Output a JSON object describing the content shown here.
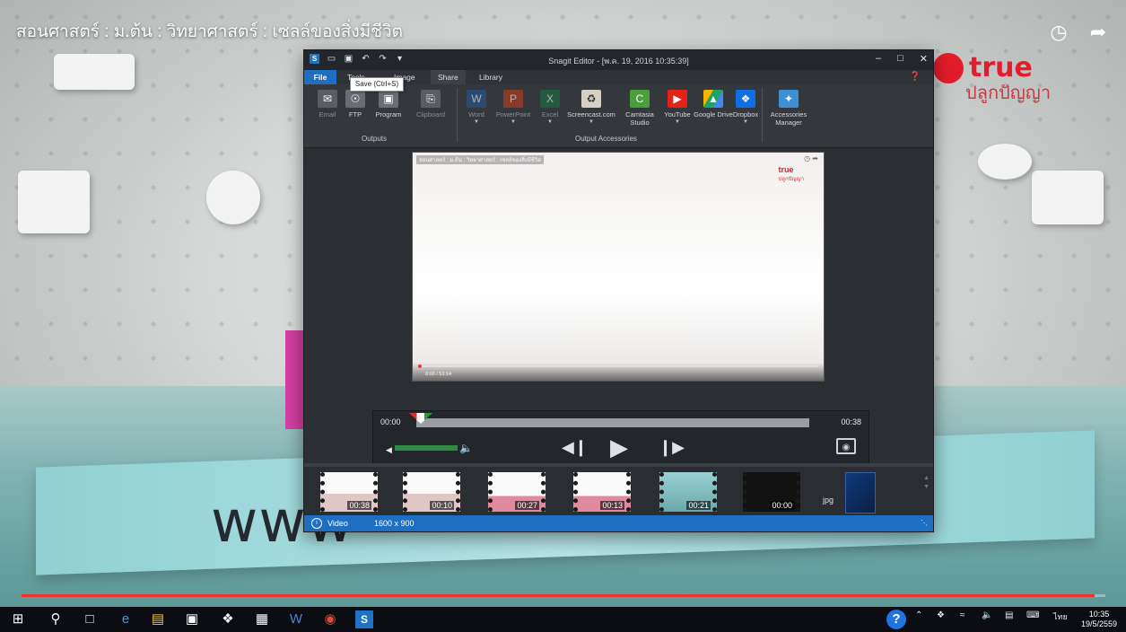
{
  "video": {
    "title": "สอนศาสตร์ : ม.ต้น : วิทยาศาสตร์ : เซลล์ของสิ่งมีชีวิต",
    "brand_name": "true",
    "brand_sub": "ปลูกปัญญา",
    "banner_text": "www",
    "progress_fraction": 0.99
  },
  "snagit": {
    "window_title": "Snagit Editor - [พ.ค. 19, 2016 10:35:39]",
    "menu": [
      "File",
      "Tools",
      "Image",
      "Share",
      "Library"
    ],
    "active_menu": "Share",
    "tooltip": "Save (Ctrl+S)",
    "outputs": {
      "label": "Outputs",
      "items": [
        "Email",
        "FTP",
        "Program",
        "Clipboard"
      ]
    },
    "accessories": {
      "label": "Output Accessories",
      "items": [
        "Word",
        "PowerPoint",
        "Excel",
        "Screencast.com",
        "Camtasia Studio",
        "YouTube",
        "Google Drive",
        "Dropbox"
      ]
    },
    "manager": "Accessories Manager",
    "capture": {
      "title": "สอนศาสตร์ : ม.ต้น : วิทยาศาสตร์ : เซลล์ของสิ่งมีชีวิต",
      "brand_name": "true",
      "brand_sub": "ปลูกปัญญา",
      "time": "0:00 / 53:14"
    },
    "player": {
      "time_start": "00:00",
      "time_end": "00:38"
    },
    "tray": {
      "thumbnails": [
        "00:38",
        "00:10",
        "00:27",
        "00:13",
        "00:21",
        "00:00"
      ],
      "jpg_label": "jpg"
    },
    "status": {
      "kind": "Video",
      "dimensions": "1600 x 900"
    }
  },
  "taskbar": {
    "lang": "ไทย",
    "time": "10:35",
    "date": "19/5/2559"
  },
  "colors": {
    "accent": "#1e6fc2",
    "brand": "#e31d2b",
    "progress": "#e33333"
  }
}
